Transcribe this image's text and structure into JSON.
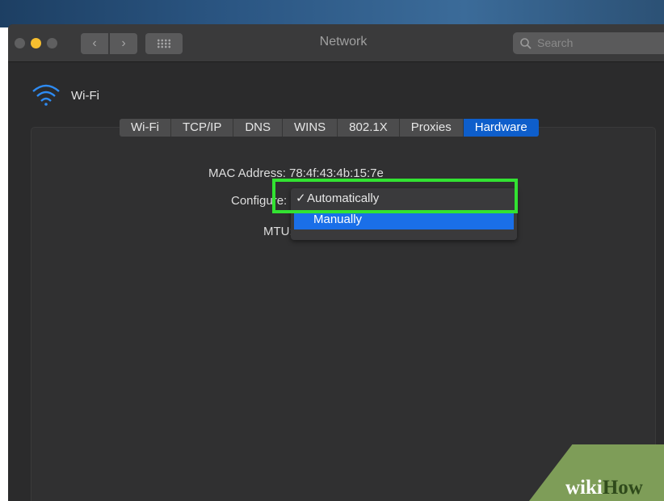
{
  "window": {
    "title": "Network",
    "search_placeholder": "Search",
    "nav_back_glyph": "‹",
    "nav_forward_glyph": "›"
  },
  "network": {
    "name": "Wi-Fi",
    "icon": "wifi-icon"
  },
  "tabs": [
    {
      "label": "Wi-Fi",
      "active": false
    },
    {
      "label": "TCP/IP",
      "active": false
    },
    {
      "label": "DNS",
      "active": false
    },
    {
      "label": "WINS",
      "active": false
    },
    {
      "label": "802.1X",
      "active": false
    },
    {
      "label": "Proxies",
      "active": false
    },
    {
      "label": "Hardware",
      "active": true
    }
  ],
  "hardware": {
    "mac_label": "MAC Address:",
    "mac_value": "78:4f:43:4b:15:7e",
    "configure_label": "Configure:",
    "mtu_label": "MTU:"
  },
  "configure_menu": {
    "options": [
      {
        "label": "Automatically",
        "checked": true
      },
      {
        "label": "Manually",
        "highlighted": true
      }
    ]
  },
  "annotation": {
    "highlight_color": "#32e232"
  },
  "watermark": {
    "part1": "wiki",
    "part2": "How"
  },
  "colors": {
    "accent": "#0e5ecb",
    "window_bg": "#2b2b2c"
  }
}
